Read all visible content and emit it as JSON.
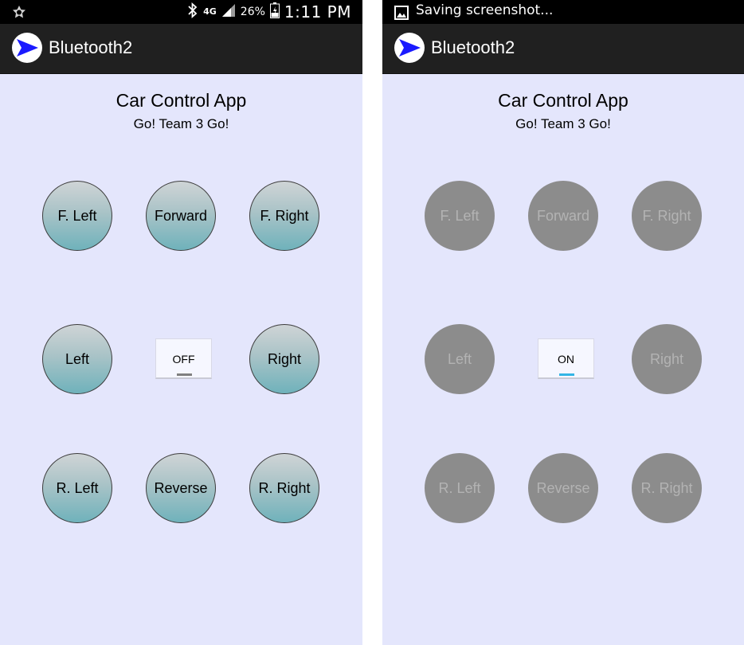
{
  "colors": {
    "background": "#e4e6fc",
    "status_bar": "#000000",
    "action_bar": "#202020",
    "button_gradient_top": "#cfd4d6",
    "button_gradient_bottom": "#6fb2bb",
    "button_disabled": "#8c8c8c",
    "toggle_off_indicator": "#808080",
    "toggle_on_indicator": "#33b5e5",
    "app_icon_blue": "#1a1aff"
  },
  "left_screen": {
    "status_bar": {
      "network": "4G",
      "battery_percent": "26%",
      "time": "1:11 PM",
      "icons": [
        "notification-icon",
        "bluetooth-icon",
        "signal-icon",
        "battery-icon"
      ]
    },
    "action_bar": {
      "title": "Bluetooth2"
    },
    "heading": "Car Control App",
    "subheading": "Go! Team 3 Go!",
    "buttons": [
      {
        "label": "F. Left"
      },
      {
        "label": "Forward"
      },
      {
        "label": "F. Right"
      },
      {
        "label": "Left"
      },
      {
        "label": "Right"
      },
      {
        "label": "R. Left"
      },
      {
        "label": "Reverse"
      },
      {
        "label": "R. Right"
      }
    ],
    "toggle": {
      "label": "OFF",
      "state": "off"
    }
  },
  "right_screen": {
    "status_bar": {
      "notification_text": "Saving screenshot...",
      "icons": [
        "screenshot-icon"
      ]
    },
    "action_bar": {
      "title": "Bluetooth2"
    },
    "heading": "Car Control App",
    "subheading": "Go! Team 3 Go!",
    "buttons": [
      {
        "label": "F. Left"
      },
      {
        "label": "Forward"
      },
      {
        "label": "F. Right"
      },
      {
        "label": "Left"
      },
      {
        "label": "Right"
      },
      {
        "label": "R. Left"
      },
      {
        "label": "Reverse"
      },
      {
        "label": "R. Right"
      }
    ],
    "toggle": {
      "label": "ON",
      "state": "on"
    }
  }
}
